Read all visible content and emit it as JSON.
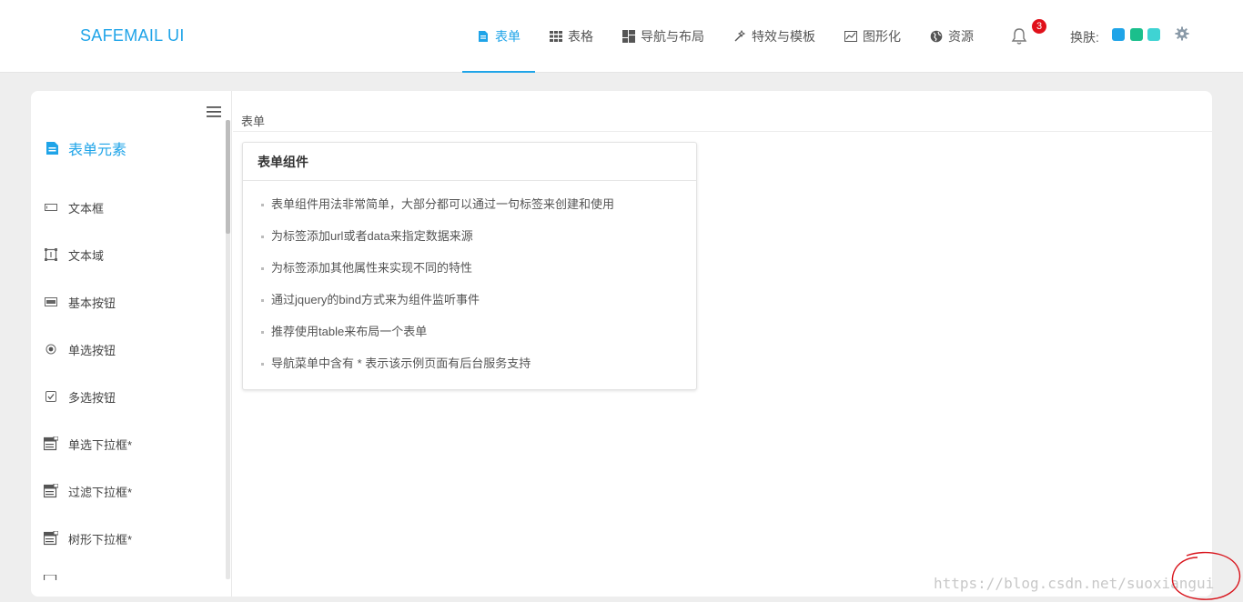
{
  "app": {
    "logo": "SAFEMAIL UI"
  },
  "nav": {
    "items": [
      {
        "label": "表单",
        "icon": "form-icon",
        "active": true
      },
      {
        "label": "表格",
        "icon": "table-icon",
        "active": false
      },
      {
        "label": "导航与布局",
        "icon": "layout-icon",
        "active": false
      },
      {
        "label": "特效与模板",
        "icon": "magic-wand-icon",
        "active": false
      },
      {
        "label": "图形化",
        "icon": "chart-icon",
        "active": false
      },
      {
        "label": "资源",
        "icon": "globe-icon",
        "active": false
      }
    ]
  },
  "header": {
    "notification_count": "3",
    "skin_label": "换肤:",
    "skin_colors": [
      "#1fa4e8",
      "#1bbf8c",
      "#3fd3d3"
    ],
    "accent_color": "#1fa4e8"
  },
  "sidebar": {
    "section_title": "表单元素",
    "items": [
      {
        "label": "文本框",
        "icon": "textbox-icon"
      },
      {
        "label": "文本域",
        "icon": "textarea-icon"
      },
      {
        "label": "基本按钮",
        "icon": "button-icon"
      },
      {
        "label": "单选按钮",
        "icon": "radio-icon"
      },
      {
        "label": "多选按钮",
        "icon": "checkbox-icon"
      },
      {
        "label": "单选下拉框*",
        "icon": "dropdown-icon"
      },
      {
        "label": "过滤下拉框*",
        "icon": "dropdown-icon"
      },
      {
        "label": "树形下拉框*",
        "icon": "dropdown-icon"
      }
    ]
  },
  "content": {
    "breadcrumb": "表单",
    "card": {
      "title": "表单组件",
      "items": [
        "表单组件用法非常简单，大部分都可以通过一句标签来创建和使用",
        "为标签添加url或者data来指定数据来源",
        "为标签添加其他属性来实现不同的特性",
        "通过jquery的bind方式来为组件监听事件",
        "推荐使用table来布局一个表单",
        "导航菜单中含有 * 表示该示例页面有后台服务支持"
      ]
    }
  },
  "watermark": "https://blog.csdn.net/suoxiangui"
}
